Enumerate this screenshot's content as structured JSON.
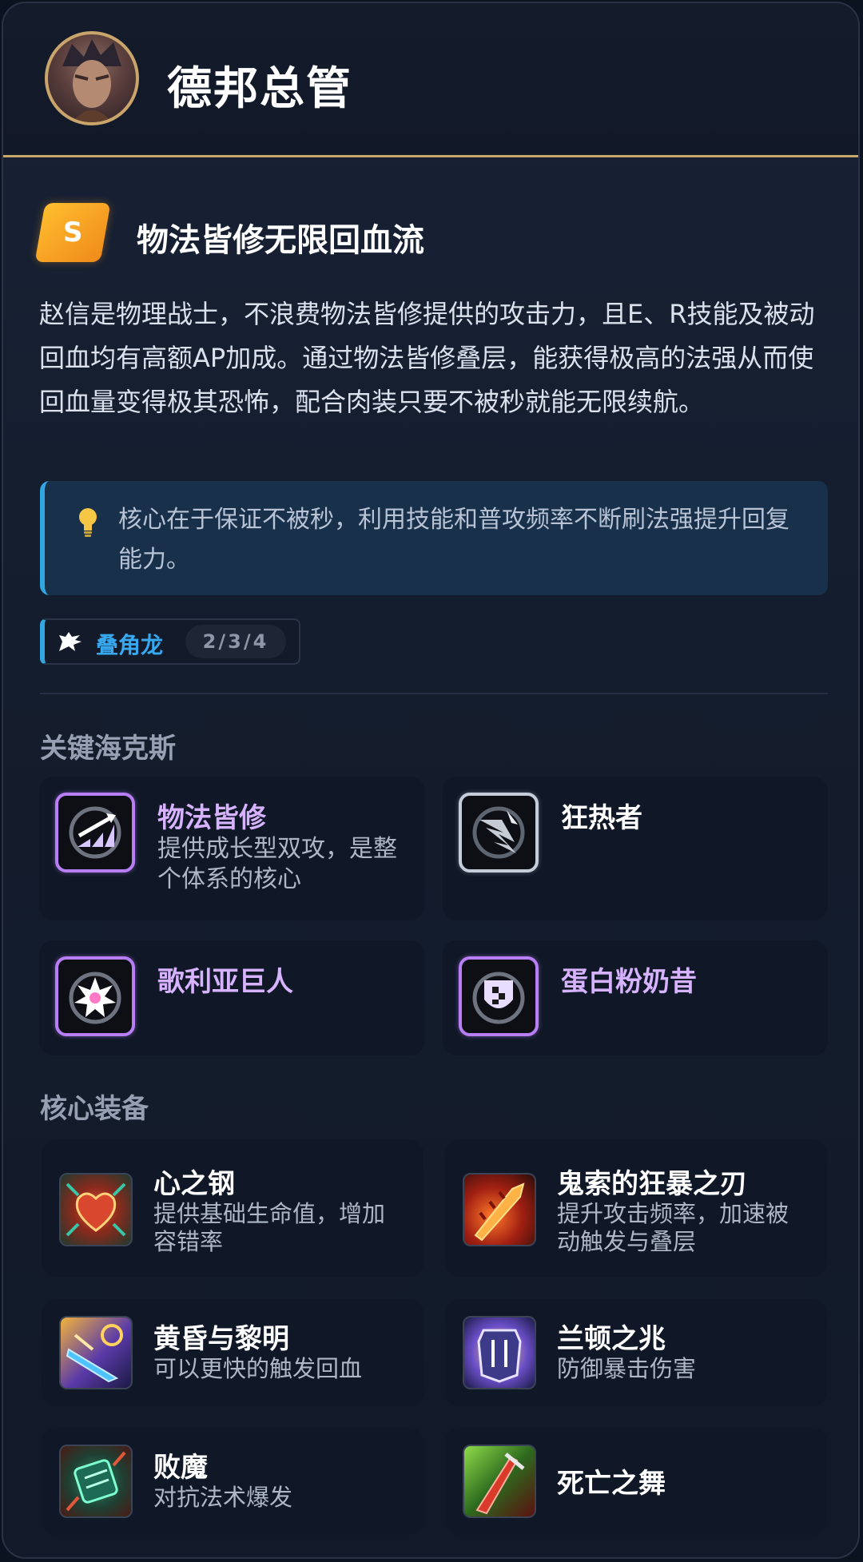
{
  "header": {
    "hero_name": "德邦总管"
  },
  "build": {
    "tier": "S",
    "title": "物法皆修无限回血流",
    "description": "赵信是物理战士，不浪费物法皆修提供的攻击力，且E、R技能及被动回血均有高额AP加成。通过物法皆修叠层，能获得极高的法强从而使回血量变得极其恐怖，配合肉装只要不被秒就能无限续航。",
    "tip": "核心在于保证不被秒，利用技能和普攻频率不断刷法强提升回复能力。"
  },
  "trait": {
    "name": "叠角龙",
    "tiers": "2/3/4"
  },
  "augments": {
    "section_title": "关键海克斯",
    "items": [
      {
        "name": "物法皆修",
        "desc": "提供成长型双攻，是整个体系的核心",
        "rarity": "prismatic",
        "icon": "adaptive-growth-icon"
      },
      {
        "name": "狂热者",
        "desc": "",
        "rarity": "silver",
        "icon": "zealot-icon"
      },
      {
        "name": "歌利亚巨人",
        "desc": "",
        "rarity": "prismatic",
        "icon": "goliath-icon"
      },
      {
        "name": "蛋白粉奶昔",
        "desc": "",
        "rarity": "prismatic",
        "icon": "protein-shake-icon"
      }
    ]
  },
  "items": {
    "section_title": "核心装备",
    "list": [
      {
        "name": "心之钢",
        "desc": "提供基础生命值，增加容错率",
        "icon": "heartsteel-icon"
      },
      {
        "name": "鬼索的狂暴之刃",
        "desc": "提升攻击频率，加速被动触发与叠层",
        "icon": "guinsoo-icon"
      },
      {
        "name": "黄昏与黎明",
        "desc": "可以更快的触发回血",
        "icon": "dusk-and-dawn-icon"
      },
      {
        "name": "兰顿之兆",
        "desc": "防御暴击伤害",
        "icon": "randuin-icon"
      },
      {
        "name": "败魔",
        "desc": "对抗法术爆发",
        "icon": "maw-icon"
      },
      {
        "name": "死亡之舞",
        "desc": "",
        "icon": "deaths-dance-icon"
      }
    ]
  },
  "colors": {
    "accent_blue": "#32a6e0",
    "gold": "#c8a86a",
    "tier_orange": "#f5a623",
    "prismatic": "#b77ef5"
  }
}
